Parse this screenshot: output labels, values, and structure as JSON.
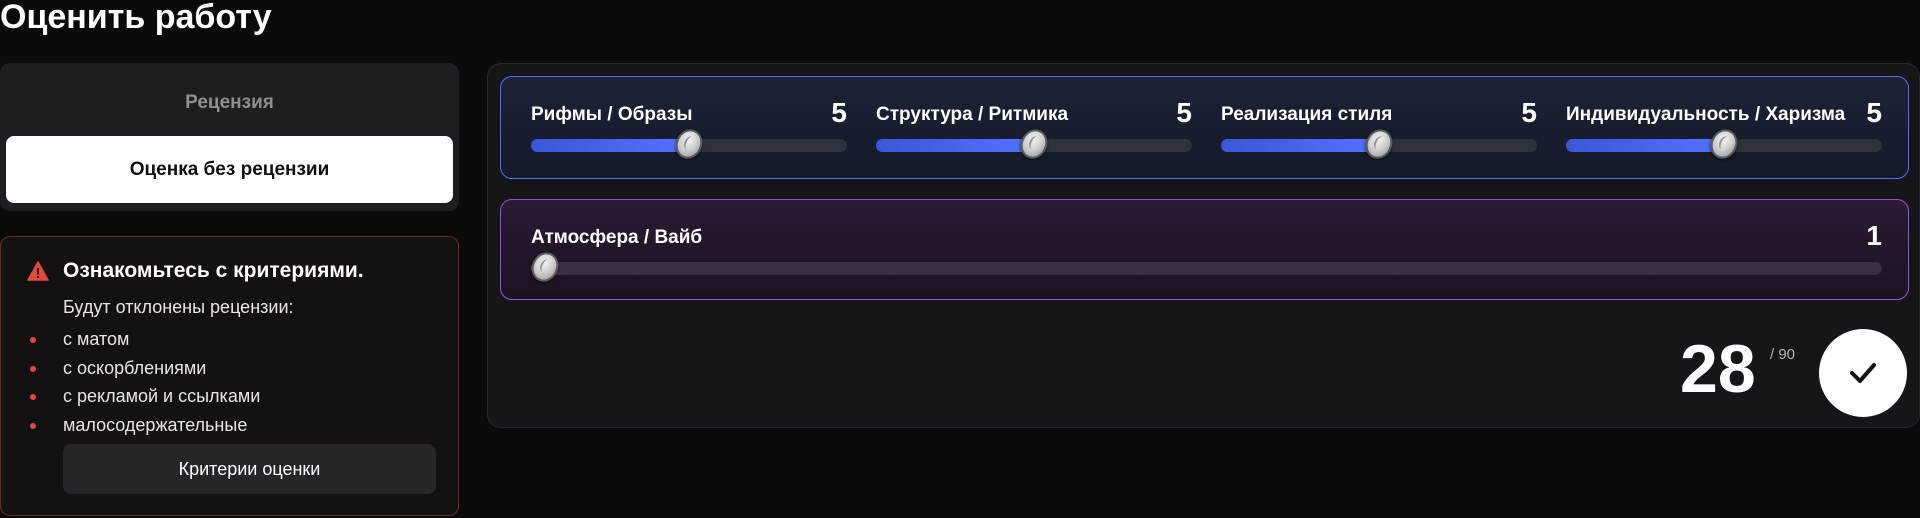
{
  "page": {
    "title": "Оценить работу"
  },
  "review_type": {
    "options": [
      {
        "label": "Рецензия",
        "active": false
      },
      {
        "label": "Оценка без рецензии",
        "active": true
      }
    ]
  },
  "warning": {
    "icon": "warning-triangle-icon",
    "title": "Ознакомьтесь с критериями.",
    "intro": "Будут отклонены рецензии:",
    "items": [
      "с матом",
      "с оскорблениями",
      "с рекламой и ссылками",
      "малосодержательные"
    ],
    "button_label": "Критерии оценки",
    "accent_color": "#e5483f"
  },
  "criteria_main": [
    {
      "label": "Рифмы / Образы",
      "value": "5",
      "level": 0.5
    },
    {
      "label": "Структура / Ритмика",
      "value": "5",
      "level": 0.5
    },
    {
      "label": "Реализация стиля",
      "value": "5",
      "level": 0.5
    },
    {
      "label": "Индивидуальность / Харизма",
      "value": "5",
      "level": 0.5
    }
  ],
  "criteria_extra": [
    {
      "label": "Атмосфера / Вайб",
      "value": "1",
      "level": 0.0
    }
  ],
  "total": {
    "score": "28",
    "max": "/ 90"
  },
  "submit": {
    "icon": "checkmark-icon"
  },
  "colors": {
    "main_accent": "#4f6cff",
    "extra_accent": "#9b4fd6",
    "background": "#0b0b0c"
  }
}
